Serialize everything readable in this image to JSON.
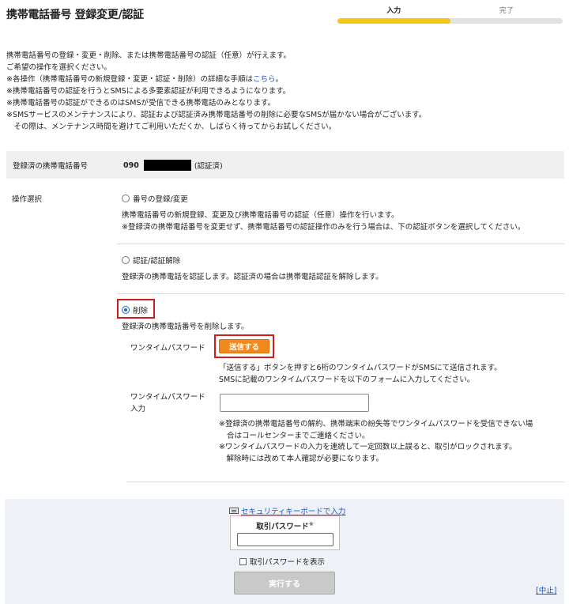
{
  "header": {
    "title": "携帯電話番号 登録変更/認証",
    "steps": [
      "入力",
      "完了"
    ],
    "progress_fraction": 0.5,
    "progress_color": "#f5c518"
  },
  "intro": {
    "line1": "携帯電話番号の登録・変更・削除、または携帯電話番号の認証（任意）が行えます。",
    "line2": "ご希望の操作を選択ください。",
    "line3_prefix": "※各操作（携帯電話番号の新規登録・変更・認証・削除）の詳細な手順は",
    "line3_link": "こちら",
    "line3_suffix": "。",
    "line4": "※携帯電話番号の認証を行うとSMSによる多要素認証が利用できるようになります。",
    "line5": "※携帯電話番号の認証ができるのはSMSが受信できる携帯電話のみとなります。",
    "line6": "※SMSサービスのメンテナンスにより、認証および認証済み携帯電話番号の削除に必要なSMSが届かない場合がございます。",
    "line7": "　その際は、メンテナンス時間を避けてご利用いただくか、しばらく待ってからお試しください。"
  },
  "registered": {
    "label": "登録済の携帯電話番号",
    "number_prefix": "090",
    "status": "(認証済)"
  },
  "operation": {
    "label": "操作選択",
    "options": [
      {
        "label": "番号の登録/変更",
        "selected": false,
        "desc1": "携帯電話番号の新規登録、変更及び携帯電話番号の認証（任意）操作を行います。",
        "desc2": "※登録済の携帯電話番号を変更せず、携帯電話番号の認証操作のみを行う場合は、下の認証ボタンを選択してください。"
      },
      {
        "label": "認証/認証解除",
        "selected": false,
        "desc1": "登録済の携帯電話を認証します。認証済の場合は携帯電話認証を解除します。"
      },
      {
        "label": "削除",
        "selected": true,
        "desc1": "登録済の携帯電話番号を削除します。"
      }
    ]
  },
  "otp": {
    "label": "ワンタイムパスワード",
    "send_button": "送信する",
    "send_note1": "「送信する」ボタンを押すと6桁のワンタイムパスワードがSMSにて送信されます。",
    "send_note2": "SMSに記載のワンタイムパスワードを以下のフォームに入力してください。",
    "input_label1": "ワンタイムパスワード",
    "input_label2": "入力",
    "input_value": "",
    "note1": "※登録済の携帯電話番号の解約、携帯端末の紛失等でワンタイムパスワードを受信できない場",
    "note2": "合はコールセンターまでご連絡ください。",
    "note3": "※ワンタイムパスワードの入力を連続して一定回数以上誤ると、取引がロックされます。",
    "note4": "　解除時には改めて本人確認が必要になります。"
  },
  "footer": {
    "keyboard_link": "セキュリティキーボードで入力",
    "password_label": "取引パスワード",
    "password_mark": "※",
    "password_value": "",
    "show_password": "取引パスワードを表示",
    "execute_button": "実行する",
    "cancel_link": "[中止]"
  }
}
